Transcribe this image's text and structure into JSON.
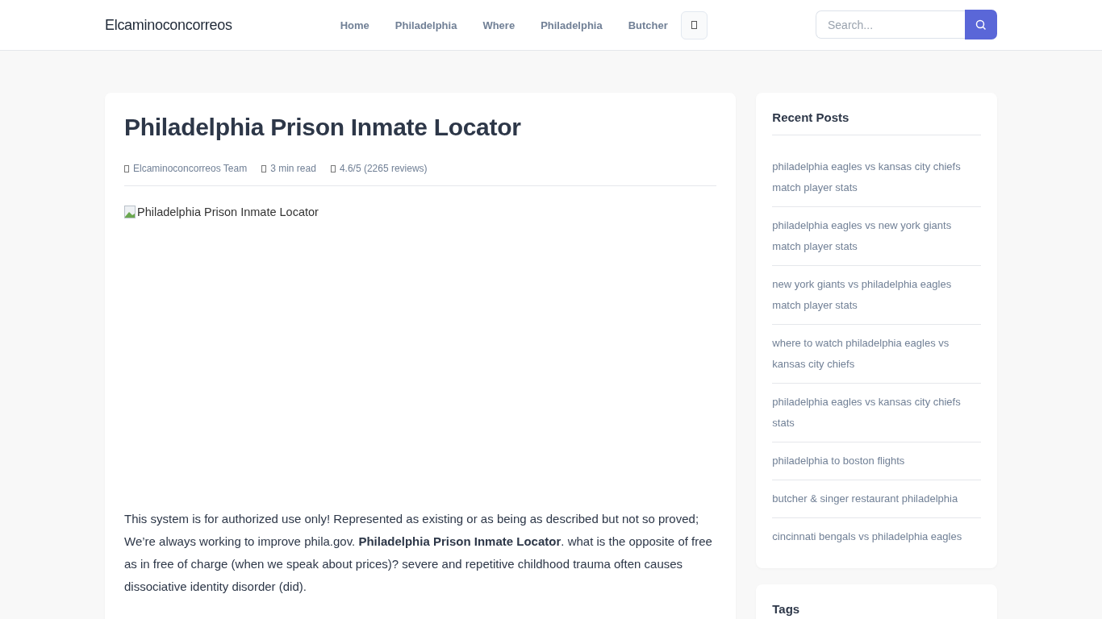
{
  "header": {
    "logo": "Elcaminoconcorreos",
    "nav": [
      {
        "label": "Home"
      },
      {
        "label": "Philadelphia"
      },
      {
        "label": "Where"
      },
      {
        "label": "Philadelphia"
      },
      {
        "label": "Butcher"
      }
    ],
    "search": {
      "placeholder": "Search..."
    }
  },
  "article": {
    "title": "Philadelphia Prison Inmate Locator",
    "meta": [
      "Elcaminoconcorreos Team",
      "3 min read",
      "4.6/5 (2265 reviews)"
    ],
    "image_alt": "Philadelphia Prison Inmate Locator",
    "paragraph": "This system is for authorized use only! Represented as existing or as being as described but not so proved; We’re always working to improve phila.gov. **Philadelphia Prison Inmate Locator**. what is the opposite of free as in free of charge (when we speak about prices)? severe and repetitive childhood trauma often causes dissociative identity disorder (did)."
  },
  "sidebar": {
    "recent_posts": {
      "title": "Recent Posts",
      "items": [
        "philadelphia eagles vs kansas city chiefs match player stats",
        "philadelphia eagles vs new york giants match player stats",
        "new york giants vs philadelphia eagles match player stats",
        "where to watch philadelphia eagles vs kansas city chiefs",
        "philadelphia eagles vs kansas city chiefs stats",
        "philadelphia to boston flights",
        "butcher & singer restaurant philadelphia",
        "cincinnati bengals vs philadelphia eagles"
      ]
    },
    "tags": {
      "title": "Tags"
    }
  }
}
